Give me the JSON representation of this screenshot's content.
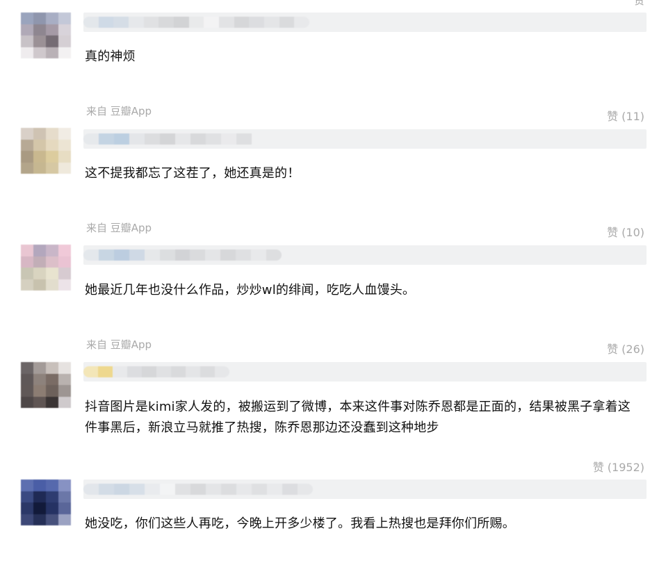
{
  "top_like_label": "赞",
  "comments": [
    {
      "text": "真的神烦",
      "source": "来自 豆瓣App",
      "like": "赞 (11)"
    },
    {
      "text": "这不提我都忘了这茬了，她还真是的！",
      "source": "来自 豆瓣App",
      "like": "赞 (10)"
    },
    {
      "text": "她最近几年也没什么作品，炒炒wl的绯闻，吃吃人血馒头。",
      "source": "来自 豆瓣App",
      "like": "赞 (26)"
    },
    {
      "text": "抖音图片是kimi家人发的，被搬运到了微博，本来这件事对陈乔恩都是正面的，结果被黑子拿着这件事黑后，新浪立马就推了热搜，陈乔恩那边还没蠢到这种地步",
      "source": "",
      "like": "赞 (1952)"
    },
    {
      "text": "她没吃，你们这些人再吃，今晚上开多少楼了。我看上热搜也是拜你们所赐。",
      "source": "",
      "like": ""
    }
  ]
}
